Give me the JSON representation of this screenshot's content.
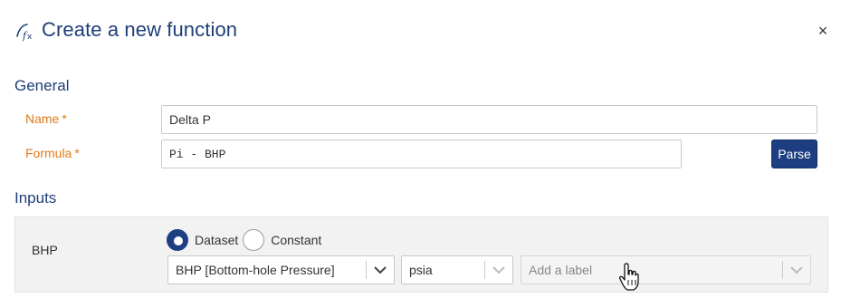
{
  "dialog": {
    "title": "Create a new function",
    "header_icon": "function-fx-icon",
    "close_symbol": "×"
  },
  "general": {
    "section_title": "General",
    "name": {
      "label": "Name",
      "required_mark": "*",
      "value": "Delta P"
    },
    "formula": {
      "label": "Formula",
      "required_mark": "*",
      "value": "Pi - BHP"
    },
    "parse_button": "Parse"
  },
  "inputs": {
    "section_title": "Inputs",
    "items": [
      {
        "variable": "BHP",
        "source_options": [
          {
            "label": "Dataset",
            "selected": true
          },
          {
            "label": "Constant",
            "selected": false
          }
        ],
        "dataset_value": "BHP [Bottom-hole Pressure]",
        "unit_value": "psia",
        "label_placeholder": "Add a label"
      }
    ]
  },
  "colors": {
    "title": "#1e3e78",
    "required_label": "#e07b18",
    "primary_button": "#1d3f82",
    "panel_bg": "#f2f2f2"
  }
}
